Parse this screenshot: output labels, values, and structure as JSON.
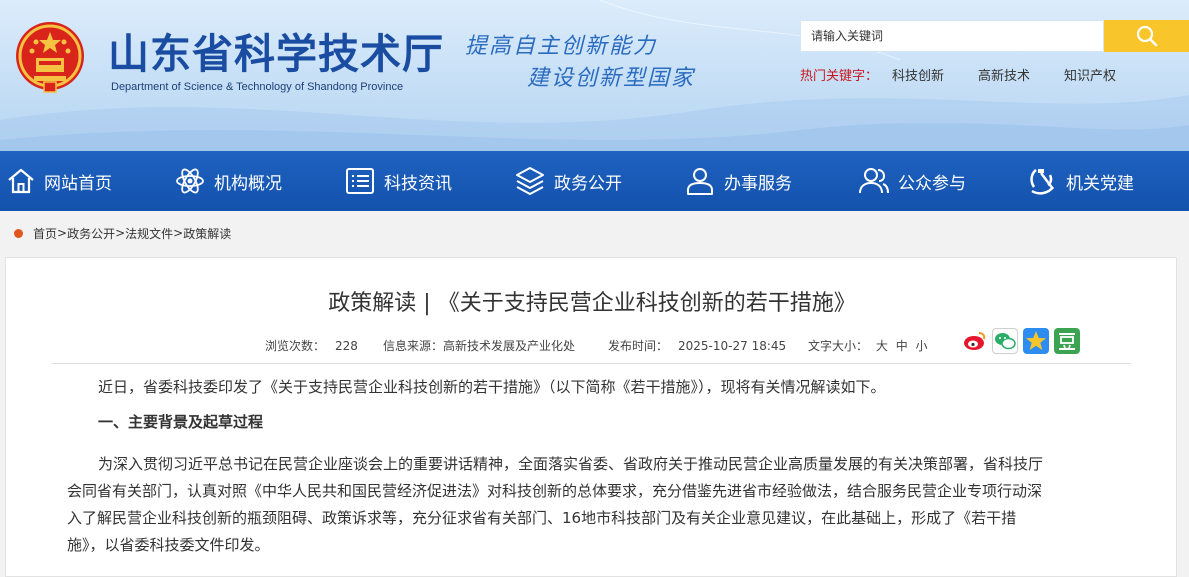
{
  "header": {
    "site_title": "山东省科学技术厅",
    "site_subtitle": "Department of Science & Technology of Shandong Province",
    "slogan_line1": "提高自主创新能力",
    "slogan_line2": "建设创新型国家",
    "search_placeholder": "请输入关键词",
    "hot_label": "热门关键字：",
    "hot_keywords": [
      "科技创新",
      "高新技术",
      "知识产权"
    ]
  },
  "nav": {
    "items": [
      {
        "label": "网站首页",
        "icon": "home-icon"
      },
      {
        "label": "机构概况",
        "icon": "atom-icon"
      },
      {
        "label": "科技资讯",
        "icon": "news-list-icon"
      },
      {
        "label": "政务公开",
        "icon": "layers-icon"
      },
      {
        "label": "办事服务",
        "icon": "user-icon"
      },
      {
        "label": "公众参与",
        "icon": "users-icon"
      },
      {
        "label": "机关党建",
        "icon": "party-emblem-icon"
      }
    ]
  },
  "breadcrumb": {
    "items": [
      "首页",
      "政务公开",
      "法规文件",
      "政策解读"
    ],
    "separator": ">"
  },
  "article": {
    "title": "政策解读 | 《关于支持民营企业科技创新的若干措施》",
    "views_label": "浏览次数：",
    "views": "228",
    "source_label": "信息来源：",
    "source": "高新技术发展及产业化处",
    "date_label": "发布时间：",
    "date": "2025-10-27 18:45",
    "font_label": "文字大小：",
    "font_sizes": [
      "大",
      "中",
      "小"
    ],
    "share_icons": [
      "weibo-icon",
      "wechat-icon",
      "qzone-star-icon",
      "douban-icon"
    ],
    "share_colors": {
      "weibo": "#e6162d",
      "wechat": "#2aae67",
      "qzone": "#2d8cf0",
      "douban": "#3ca353"
    },
    "paragraph1": "近日，省委科技委印发了《关于支持民营企业科技创新的若干措施》（以下简称《若干措施》），现将有关情况解读如下。",
    "heading1": "一、主要背景及起草过程",
    "paragraph2_lines": [
      "为深入贯彻习近平总书记在民营企业座谈会上的重要讲话精神，全面落实省委、省政府关于推动民营企业高质量发展的有关决策部署，省科技厅",
      "会同省有关部门，认真对照《中华人民共和国民营经济促进法》对科技创新的总体要求，充分借鉴先进省市经验做法，结合服务民营企业专项行动深",
      "入了解民营企业科技创新的瓶颈阻碍、政策诉求等，充分征求省有关部门、16地市科技部门及有关企业意见建议，在此基础上，形成了《若干措",
      "施》，以省委科技委文件印发。"
    ]
  },
  "colors": {
    "brand_blue": "#1a4da1",
    "nav_blue": "#1352ad",
    "search_yellow": "#f8c52a",
    "hot_red": "#c9171e",
    "crumb_orange": "#e0561d"
  }
}
